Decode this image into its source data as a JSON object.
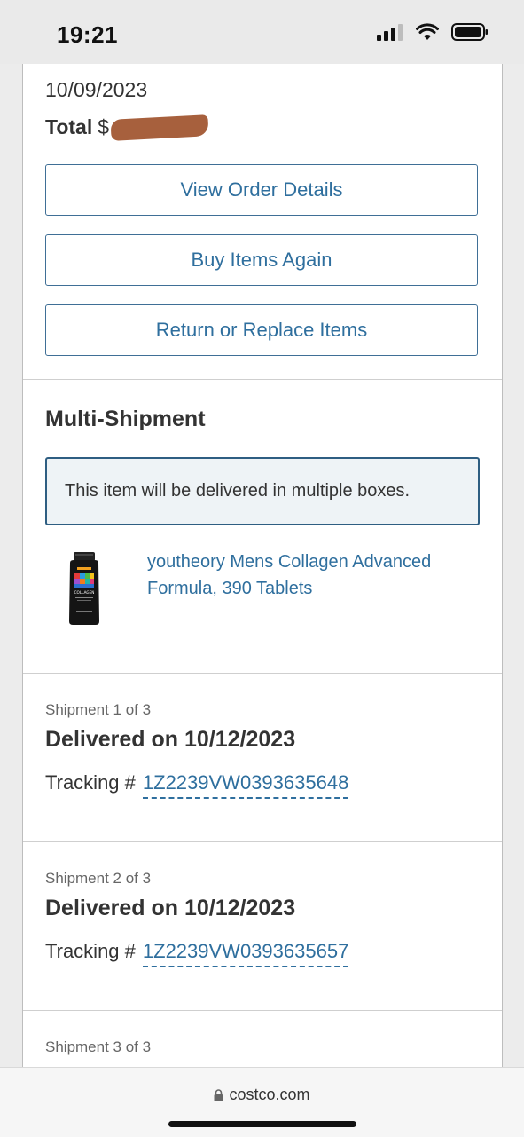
{
  "status_bar": {
    "time": "19:21",
    "icons": [
      "cellular-signal-icon",
      "wifi-icon",
      "battery-icon"
    ]
  },
  "order": {
    "date": "10/09/2023",
    "total_label": "Total",
    "total_currency": "$",
    "total_value_redacted": true,
    "buttons": {
      "view_order": "View Order Details",
      "buy_again": "Buy Items Again",
      "return_replace": "Return or Replace Items"
    }
  },
  "multi_shipment": {
    "title": "Multi-Shipment",
    "notice": "This item will be delivered in multiple boxes.",
    "product": {
      "name": "youtheory Mens Collagen Advanced Formula, 390 Tablets",
      "image_label": "COLLAGEN"
    }
  },
  "shipments": [
    {
      "label": "Shipment 1 of 3",
      "status": "Delivered on 10/12/2023",
      "tracking_label": "Tracking #",
      "tracking_number": "1Z2239VW0393635648"
    },
    {
      "label": "Shipment 2 of 3",
      "status": "Delivered on 10/12/2023",
      "tracking_label": "Tracking #",
      "tracking_number": "1Z2239VW0393635657"
    },
    {
      "label": "Shipment 3 of 3"
    }
  ],
  "browser": {
    "url": "costco.com"
  },
  "colors": {
    "link": "#2f6f9e",
    "button_border": "#3f6f96",
    "info_border": "#2e5e82",
    "info_bg": "#eef3f6",
    "redaction": "#a0522d"
  }
}
